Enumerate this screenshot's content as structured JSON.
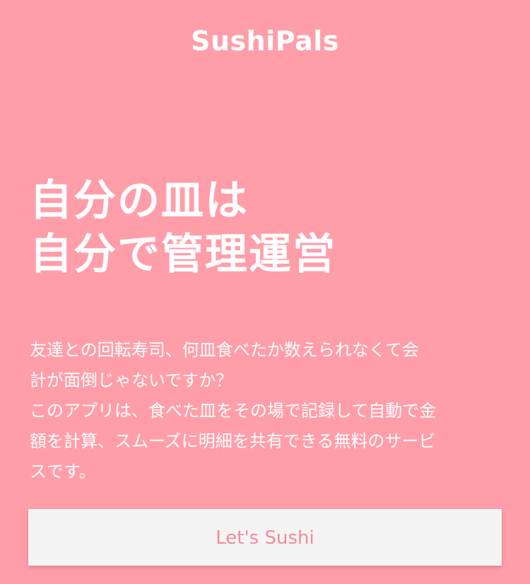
{
  "header": {
    "brand": "SushiPals"
  },
  "hero": {
    "headline_line1": "自分の皿は",
    "headline_line2": "自分で管理運営"
  },
  "description": {
    "lines": [
      "友達との回転寿司、何皿食べたか数えられなくて会",
      "計が面倒じゃないですか？",
      "このアプリは、食べた皿をその場で記録して自動で金",
      "額を計算、スムーズに明細を共有できる無料のサービ",
      "スです。"
    ]
  },
  "cta": {
    "label": "Let's Sushi"
  },
  "colors": {
    "background": "#FF9EA9",
    "text": "#FFFFFF",
    "button_bg": "#F4F4F4",
    "button_text": "#F58A98"
  }
}
